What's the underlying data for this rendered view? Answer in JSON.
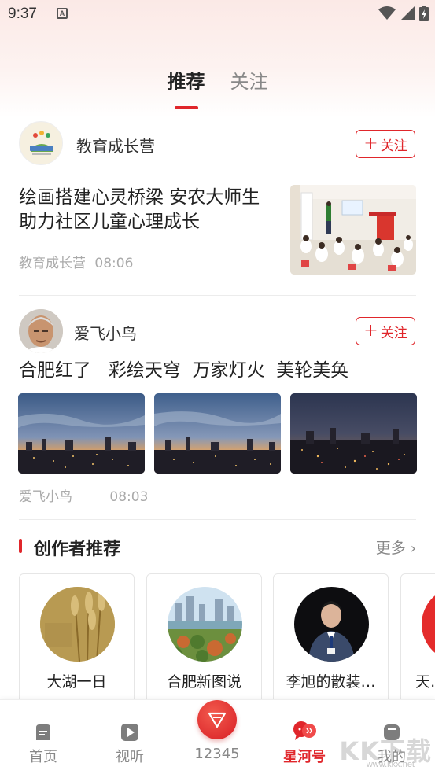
{
  "status_bar": {
    "time": "9:37",
    "notification_glyph": "A"
  },
  "tabs": [
    {
      "label": "推荐",
      "active": true
    },
    {
      "label": "关注",
      "active": false
    }
  ],
  "article1": {
    "author": "教育成长营",
    "follow_label": "关注",
    "title_line1": "绘画搭建心灵桥梁  安农大师生",
    "title_line2": "助力社区儿童心理成长",
    "source": "教育成长营",
    "time": "08:06"
  },
  "article2": {
    "author": "爱飞小鸟",
    "follow_label": "关注",
    "title": "合肥红了   彩绘天穹  万家灯火  美轮美奂",
    "source": "爱飞小鸟",
    "time": "08:03"
  },
  "creators_section": {
    "title": "创作者推荐",
    "more_label": "更多",
    "creators": [
      {
        "name": "大湖一日"
      },
      {
        "name": "合肥新图说"
      },
      {
        "name": "李旭的散装…"
      },
      {
        "name": "天…"
      }
    ]
  },
  "bottom_nav": {
    "items": [
      {
        "label": "首页",
        "icon": "home-icon",
        "active": false
      },
      {
        "label": "视听",
        "icon": "play-icon",
        "active": false
      },
      {
        "label": "12345",
        "icon": "hotline-icon",
        "active": false
      },
      {
        "label": "星河号",
        "icon": "xinghe-icon",
        "active": true
      },
      {
        "label": "我的",
        "icon": "profile-icon",
        "active": false
      }
    ]
  },
  "watermark": {
    "text": "KK下载",
    "url": "www.kkx.net"
  },
  "colors": {
    "accent": "#e0262b",
    "muted": "#888888",
    "meta": "#aaaaaa"
  }
}
